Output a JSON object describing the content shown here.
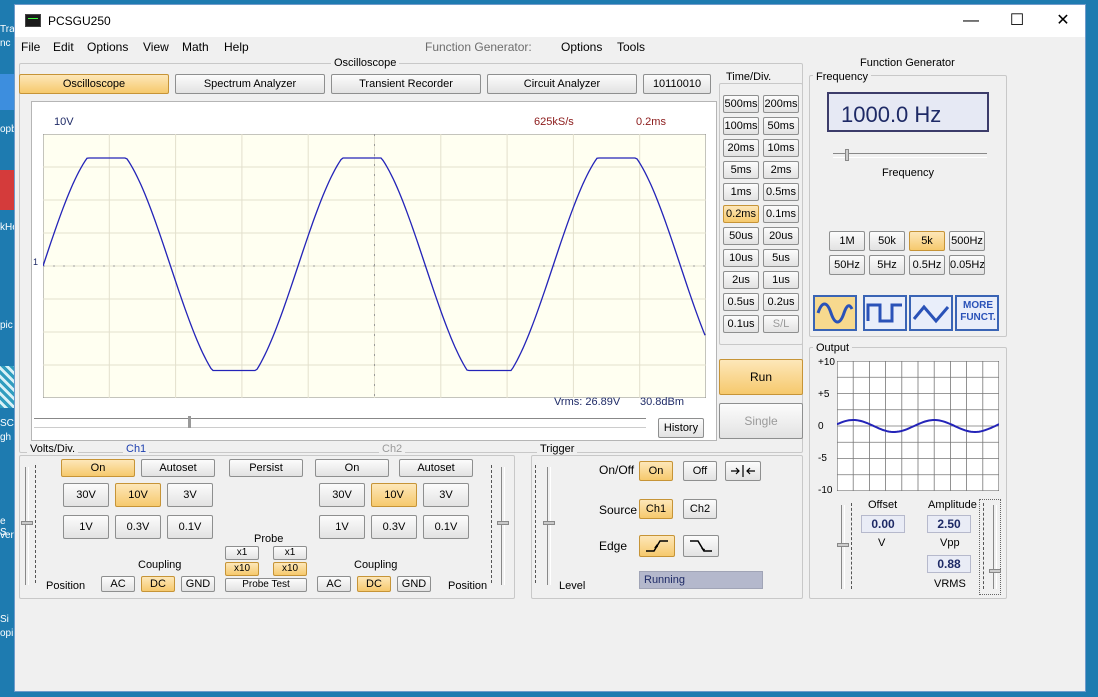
{
  "desktop": {
    "fragments": [
      "Tra",
      "nc",
      "opb",
      "kHe",
      "pic",
      "SC",
      "gh",
      "e S",
      "ver",
      "Si",
      "opi"
    ]
  },
  "window": {
    "title": "PCSGU250",
    "controls": {
      "minimize": "—",
      "maximize": "☐",
      "close": "✕"
    }
  },
  "menu": {
    "file": "File",
    "edit": "Edit",
    "options": "Options",
    "view": "View",
    "math": "Math",
    "help": "Help",
    "fg_label": "Function Generator:",
    "fg_options": "Options",
    "fg_tools": "Tools"
  },
  "osc_group_title": "Oscilloscope",
  "tabs": {
    "oscilloscope": "Oscilloscope",
    "spectrum": "Spectrum Analyzer",
    "transient": "Transient Recorder",
    "circuit": "Circuit Analyzer",
    "bits": "10110010"
  },
  "scope": {
    "volt_label": "10V",
    "sample_rate": "625kS/s",
    "timebase": "0.2ms",
    "marker": "1",
    "vrms": "Vrms: 26.89V",
    "dbm": "30.8dBm",
    "history": "History",
    "trace_color": "#2424b8",
    "amplitude_fraction": 0.88,
    "cycles": 2.6
  },
  "timediv": {
    "title": "Time/Div.",
    "buttons": [
      "500ms",
      "200ms",
      "100ms",
      "50ms",
      "20ms",
      "10ms",
      "5ms",
      "2ms",
      "1ms",
      "0.5ms",
      "0.2ms",
      "0.1ms",
      "50us",
      "20us",
      "10us",
      "5us",
      "2us",
      "1us",
      "0.5us",
      "0.2us",
      "0.1us",
      "S/L"
    ],
    "selected": "0.2ms",
    "run": "Run",
    "single": "Single"
  },
  "volts": {
    "title": "Volts/Div.",
    "ch1": "Ch1",
    "ch2": "Ch2",
    "on": "On",
    "autoset": "Autoset",
    "persist": "Persist",
    "ranges": [
      "30V",
      "10V",
      "3V",
      "1V",
      "0.3V",
      "0.1V"
    ],
    "selected": "10V",
    "probe": "Probe",
    "x1": "x1",
    "x10": "x10",
    "probe_test": "Probe Test",
    "coupling": "Coupling",
    "ac": "AC",
    "dc": "DC",
    "gnd": "GND",
    "position": "Position"
  },
  "trigger": {
    "title": "Trigger",
    "onoff": "On/Off",
    "on": "On",
    "off": "Off",
    "source": "Source",
    "ch1": "Ch1",
    "ch2": "Ch2",
    "edge": "Edge",
    "level": "Level",
    "status": "Running"
  },
  "fg": {
    "title": "Function Generator",
    "frequency_title": "Frequency",
    "freq_value": "1000.0 Hz",
    "slider_label": "Frequency",
    "ranges": [
      "1M",
      "50k",
      "5k",
      "500Hz",
      "50Hz",
      "5Hz",
      "0.5Hz",
      "0.05Hz"
    ],
    "selected": "5k",
    "more": "MORE FUNCT.",
    "output_title": "Output",
    "y_ticks": [
      "+10",
      "+5",
      "0",
      "-5",
      "-10"
    ],
    "offset_label": "Offset",
    "offset_value": "0.00",
    "offset_unit": "V",
    "amp_label": "Amplitude",
    "amp_value": "2.50",
    "amp_unit": "Vpp",
    "vrms_value": "0.88",
    "vrms_unit": "VRMS"
  }
}
